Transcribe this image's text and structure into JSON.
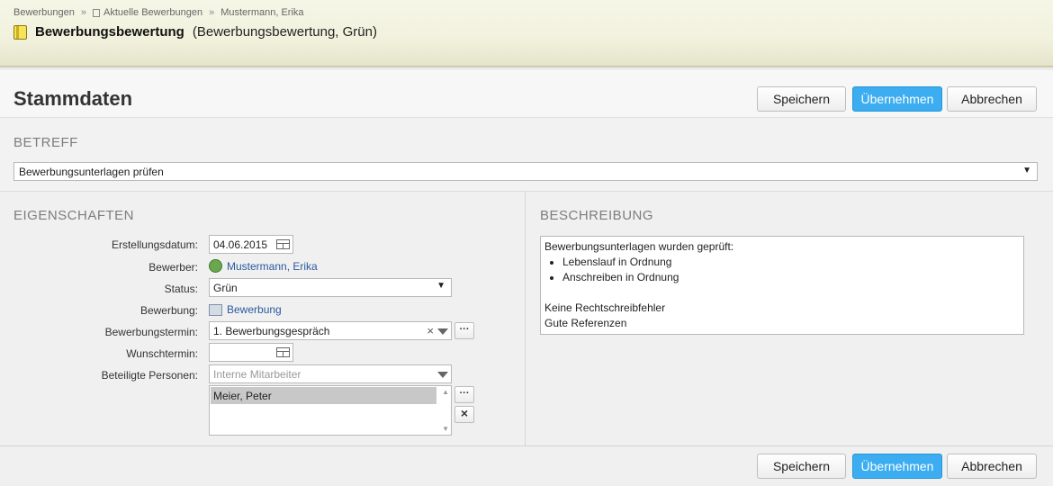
{
  "breadcrumb": {
    "items": [
      "Bewerbungen",
      "Aktuelle Bewerbungen",
      "Mustermann, Erika"
    ],
    "separator": "»"
  },
  "header": {
    "title": "Bewerbungsbewertung",
    "subtitle": "(Bewerbungsbewertung, Grün)"
  },
  "page_title": "Stammdaten",
  "buttons": {
    "save": "Speichern",
    "apply": "Übernehmen",
    "cancel": "Abbrechen"
  },
  "betreff": {
    "heading": "BETREFF",
    "value": "Bewerbungsunterlagen prüfen"
  },
  "eigenschaften": {
    "heading": "EIGENSCHAFTEN",
    "labels": {
      "erstellungsdatum": "Erstellungsdatum:",
      "bewerber": "Bewerber:",
      "status": "Status:",
      "bewerbung": "Bewerbung:",
      "bewerbungstermin": "Bewerbungstermin:",
      "wunschtermin": "Wunschtermin:",
      "beteiligte": "Beteiligte Personen:"
    },
    "values": {
      "erstellungsdatum": "04.06.2015",
      "bewerber": "Mustermann, Erika",
      "status": "Grün",
      "bewerbung": "Bewerbung",
      "bewerbungstermin": "1. Bewerbungsgespräch",
      "wunschtermin": "",
      "beteiligte_placeholder": "Interne Mitarbeiter",
      "beteiligte_list": [
        "Meier, Peter"
      ]
    },
    "small_buttons": {
      "more": "···",
      "remove": "×"
    }
  },
  "beschreibung": {
    "heading": "BESCHREIBUNG",
    "intro": "Bewerbungsunterlagen wurden geprüft:",
    "bullets": [
      "Lebenslauf in Ordnung",
      "Anschreiben in Ordnung"
    ],
    "lines": [
      "Keine Rechtschreibfehler",
      "Gute Referenzen"
    ]
  },
  "colors": {
    "primary_button": "#3badf0",
    "link": "#2a5aa0",
    "header_bg": "#f1f1dd"
  }
}
